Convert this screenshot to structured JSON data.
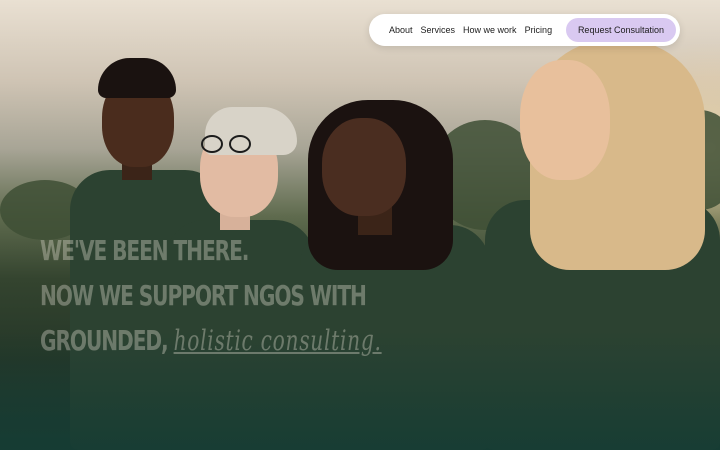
{
  "nav": {
    "links": [
      "About",
      "Services",
      "How we work",
      "Pricing"
    ],
    "cta_label": "Request Consultation"
  },
  "hero": {
    "headline_line1": "We've been there.",
    "headline_line2": "Now we support NGOs with",
    "headline_line3_prefix": "grounded,",
    "headline_line3_script": "holistic consulting."
  },
  "colors": {
    "cta_background": "#d9c9f1",
    "nav_background": "#ffffff",
    "shirt": "#2c4231"
  }
}
